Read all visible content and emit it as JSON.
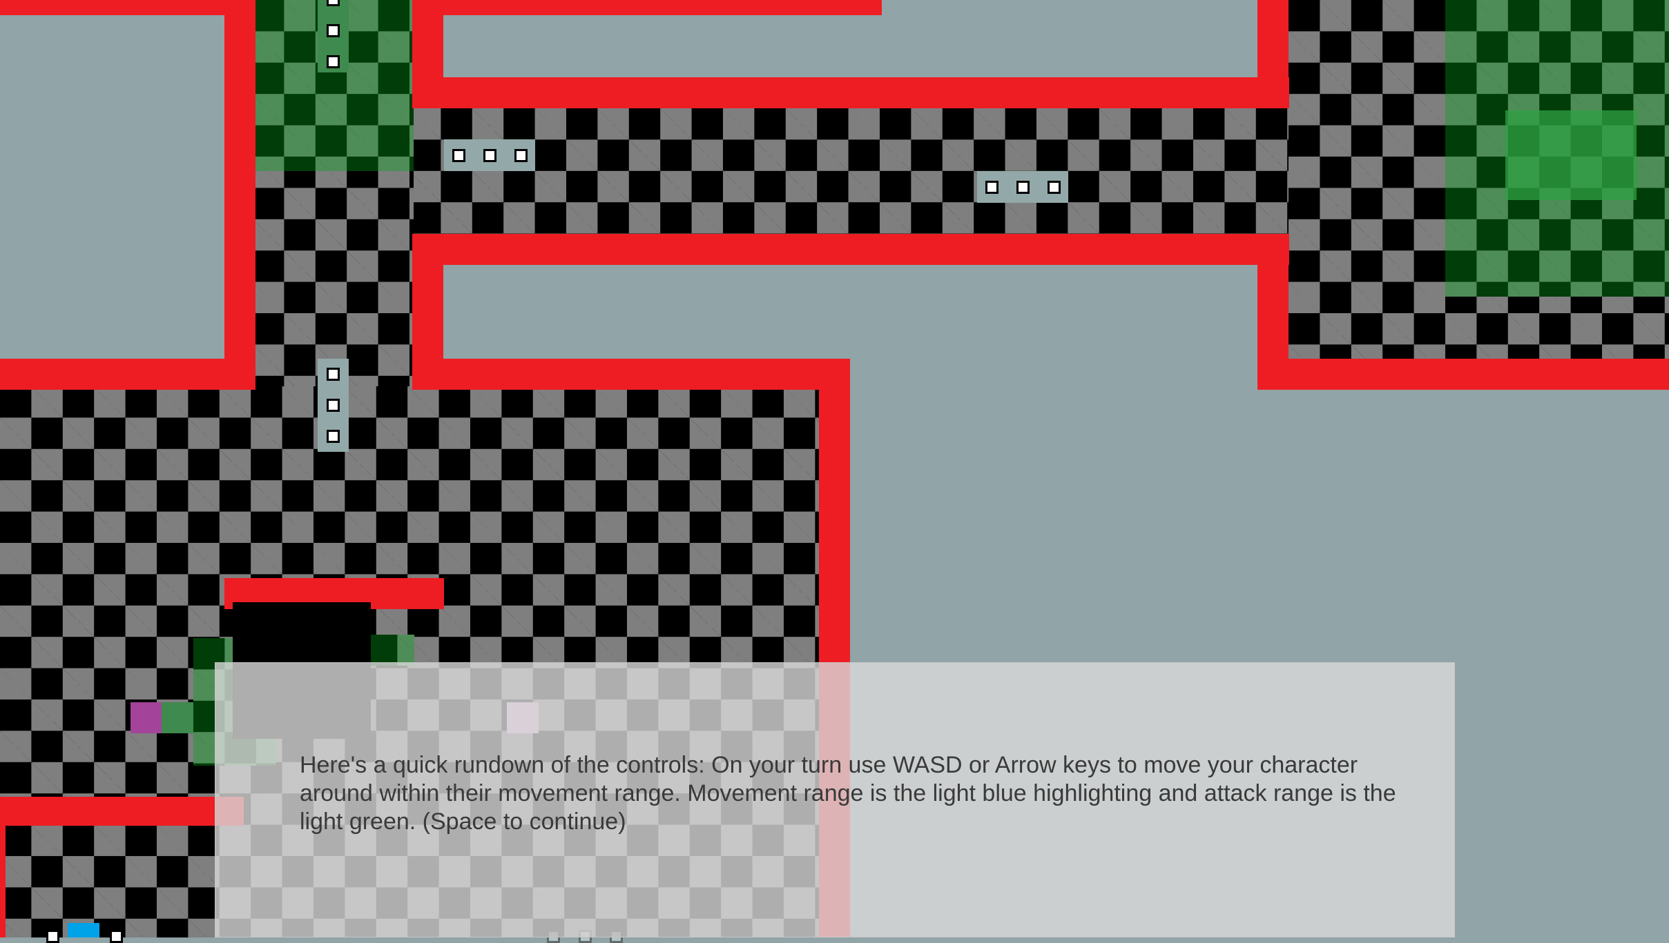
{
  "dialog": {
    "text": "Here's a quick rundown of the controls: On your turn use WASD or Arrow keys to move your character around within their movement range. Movement range is the light blue highlighting and attack range is the light green. (Space to continue)"
  },
  "colors": {
    "background": "#91a4a7",
    "wall": "#ee1d24",
    "tile_dark": "#000000",
    "tile_light": "#7f7f7f",
    "attack_range_green": "#4e8d57",
    "movement_range_blue": "#00a2e8",
    "enemy_purple": "#a3449a",
    "dialog_panel": "#dadada"
  },
  "icons": {
    "marker": "white-square-marker",
    "enemy": "purple-tile",
    "player": "blue-tile"
  }
}
